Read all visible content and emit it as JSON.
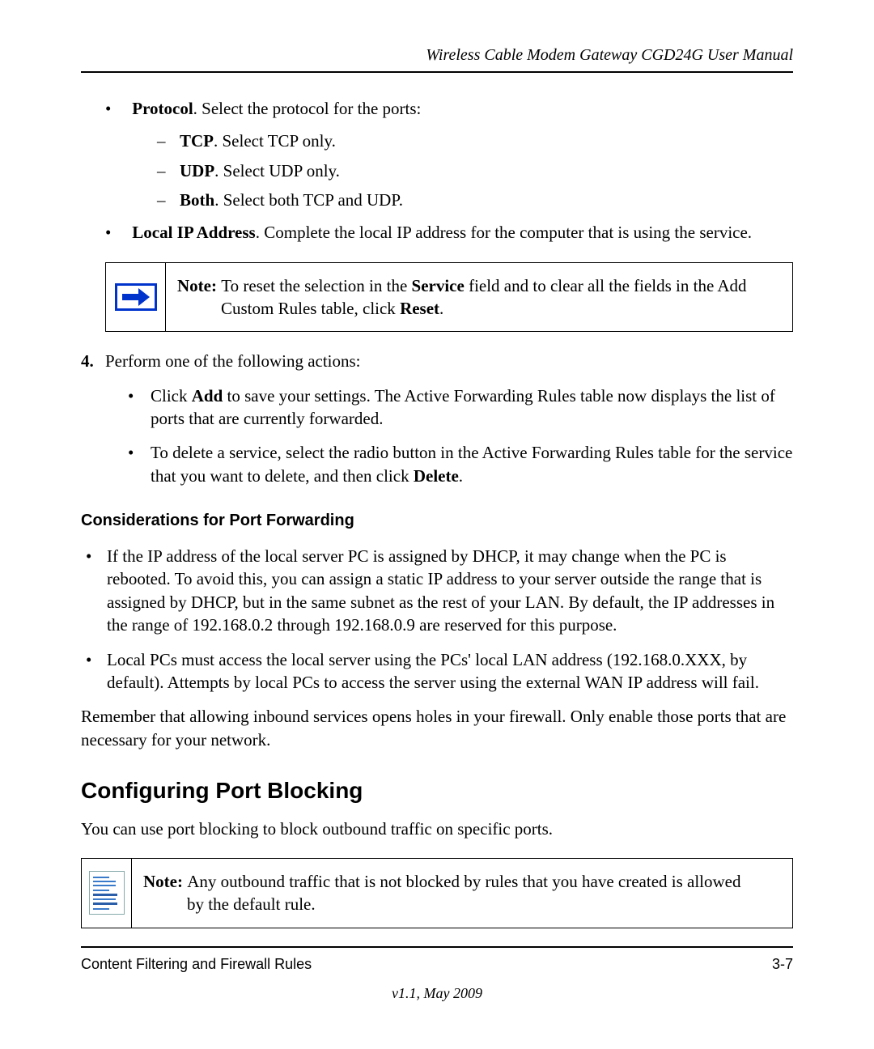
{
  "header": {
    "title": "Wireless Cable Modem Gateway CGD24G User Manual"
  },
  "bullets": {
    "protocol": {
      "label_bold": "Protocol",
      "label_rest": ". Select the protocol for the ports:",
      "items": {
        "tcp_bold": "TCP",
        "tcp_rest": ". Select TCP only.",
        "udp_bold": "UDP",
        "udp_rest": ". Select UDP only.",
        "both_bold": "Both",
        "both_rest": ". Select both TCP and UDP."
      }
    },
    "local_ip": {
      "label_bold": "Local IP Address",
      "label_rest": ". Complete the local IP address for the computer that is using the service."
    }
  },
  "note1": {
    "prefix": "Note: ",
    "line1a": "To reset the selection in the ",
    "line1b_bold": "Service",
    "line1c": " field and to clear all the fields in the Add",
    "line2a": "Custom Rules table, click ",
    "line2b_bold": "Reset",
    "line2c": "."
  },
  "step4": {
    "num": "4.",
    "text": "Perform one of the following actions:",
    "sub1a": "Click ",
    "sub1b_bold": "Add",
    "sub1c": " to save your settings. The Active Forwarding Rules table now displays the list of ports that are currently forwarded.",
    "sub2a": "To delete a service, select the radio button in the Active Forwarding Rules table for the service that you want to delete, and then click ",
    "sub2b_bold": "Delete",
    "sub2c": "."
  },
  "h3": "Considerations for Port Forwarding",
  "consider": {
    "b1": "If the IP address of the local server PC is assigned by DHCP, it may change when the PC is rebooted. To avoid this, you can assign a static IP address to your server outside the range that is assigned by DHCP, but in the same subnet as the rest of your LAN. By default, the IP addresses in the range of 192.168.0.2 through 192.168.0.9 are reserved for this purpose.",
    "b2": "Local PCs must access the local server using the PCs' local LAN address (192.168.0.XXX, by default). Attempts by local PCs to access the server using the external WAN IP address will fail."
  },
  "para1": "Remember that allowing inbound services opens holes in your firewall. Only enable those ports that are necessary for your network.",
  "h2": "Configuring Port Blocking",
  "para2": "You can use port blocking to block outbound traffic on specific ports.",
  "note2": {
    "prefix": "Note: ",
    "line1": "Any outbound traffic that is not blocked by rules that you have created is allowed",
    "line2": "by the default rule."
  },
  "footer": {
    "left": "Content Filtering and Firewall Rules",
    "right": "3-7",
    "version": "v1.1, May 2009"
  }
}
